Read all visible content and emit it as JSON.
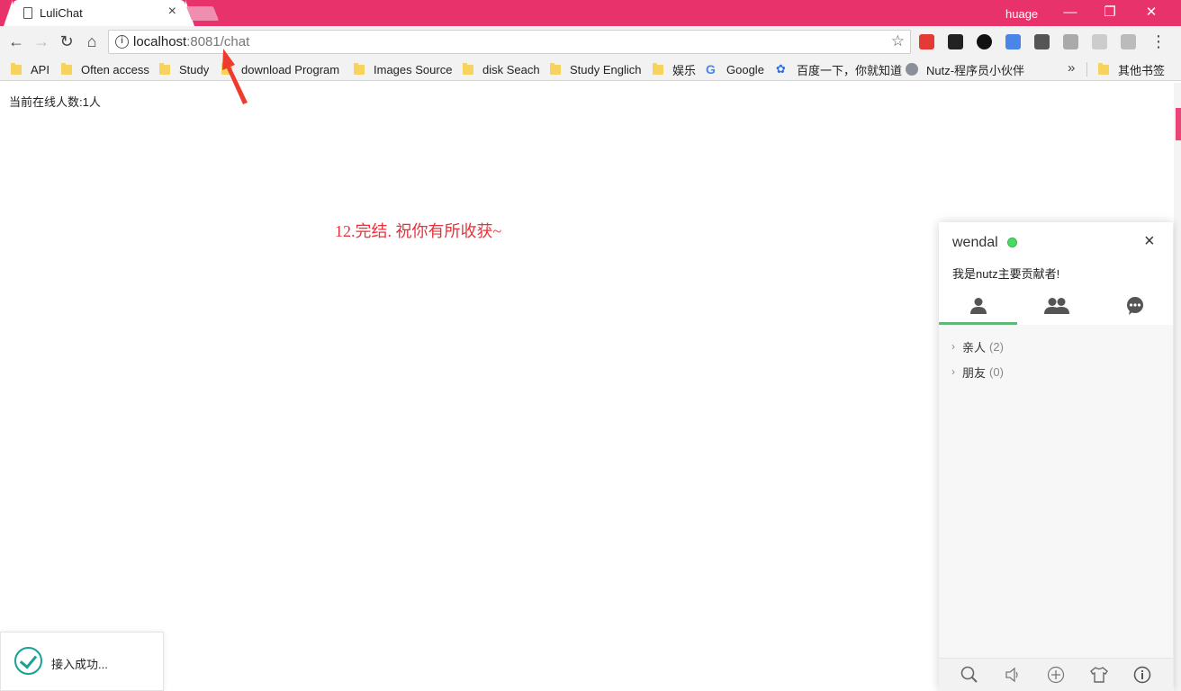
{
  "browser": {
    "tab_title": "LuliChat",
    "tab_close": "×",
    "profile_name": "huage",
    "url_host": "localhost",
    "url_rest": ":8081/chat"
  },
  "bookmarks": {
    "items": [
      {
        "label": "API"
      },
      {
        "label": "Often access"
      },
      {
        "label": "Study"
      },
      {
        "label": "download Program"
      },
      {
        "label": "Images Source"
      },
      {
        "label": "disk Seach"
      },
      {
        "label": "Study Englich"
      },
      {
        "label": "娱乐"
      },
      {
        "label": "Google"
      },
      {
        "label": "百度一下，你就知道"
      },
      {
        "label": "Nutz-程序员小伙伴"
      },
      {
        "label": "其他书签"
      }
    ],
    "more": "»"
  },
  "page": {
    "online_count": "当前在线人数:1人",
    "caption": "12.完结. 祝你有所收获~"
  },
  "toast": {
    "message": "接入成功..."
  },
  "chat_panel": {
    "user_name": "wendal",
    "status_color": "#4cd964",
    "signature": "我是nutz主要贡献者!",
    "close": "×",
    "tabs": [
      {
        "icon": "friend-icon"
      },
      {
        "icon": "group-icon"
      },
      {
        "icon": "history-icon"
      }
    ],
    "groups": [
      {
        "name": "亲人",
        "count": "(2)"
      },
      {
        "name": "朋友",
        "count": "(0)"
      }
    ],
    "footer_icons": [
      "search-icon",
      "sound-icon",
      "add-icon",
      "skin-icon",
      "about-icon"
    ]
  },
  "colors": {
    "titlebar": "#e8326c",
    "accent_tab": "#5fb878",
    "caption": "#e8323c"
  }
}
